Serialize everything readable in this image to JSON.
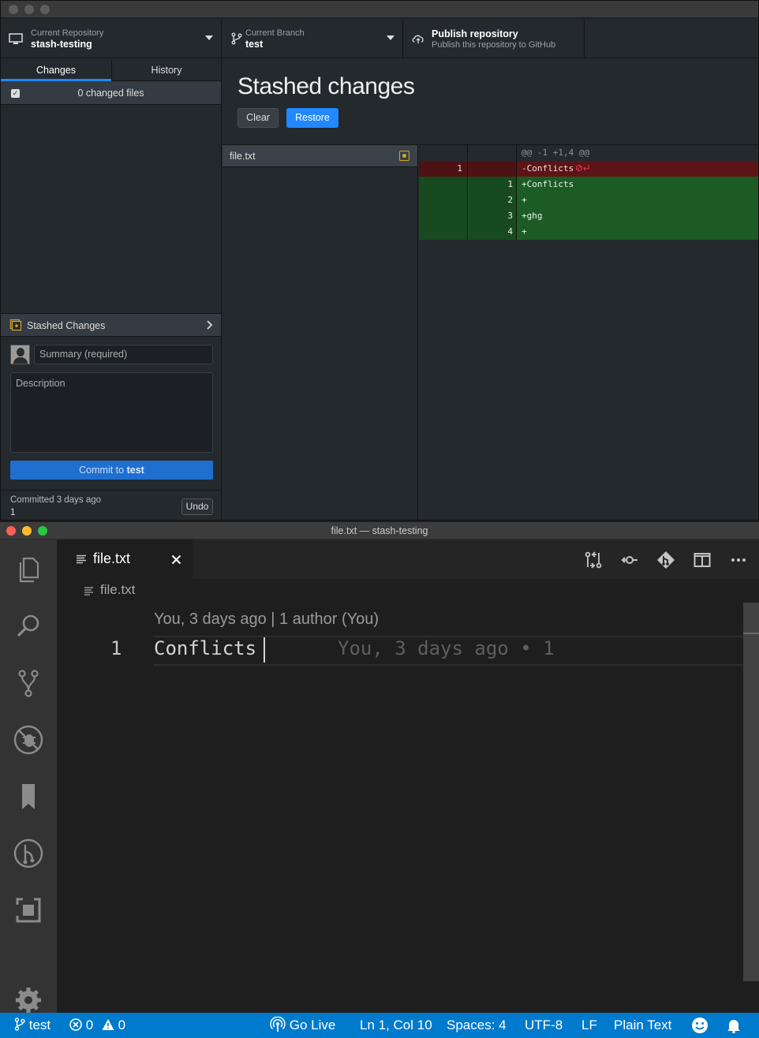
{
  "github_desktop": {
    "toolbar": {
      "repo_small": "Current Repository",
      "repo_name": "stash-testing",
      "branch_small": "Current Branch",
      "branch_name": "test",
      "publish_title": "Publish repository",
      "publish_sub": "Publish this repository to GitHub"
    },
    "tabs": [
      "Changes",
      "History"
    ],
    "changed_files": "0 changed files",
    "stashed_changes_label": "Stashed Changes",
    "summary_placeholder": "Summary (required)",
    "description_placeholder": "Description",
    "commit_prefix": "Commit to",
    "commit_branch": "test",
    "committed_label": "Committed 3 days ago",
    "committed_message": "1",
    "undo_label": "Undo",
    "main": {
      "title": "Stashed changes",
      "clear_label": "Clear",
      "restore_label": "Restore",
      "file_name": "file.txt"
    },
    "diff": {
      "hunk": "@@ -1 +1,4 @@",
      "lines": [
        {
          "type": "del",
          "old": "1",
          "new": "",
          "text": "-Conflicts"
        },
        {
          "type": "add",
          "old": "",
          "new": "1",
          "text": "+Conflicts"
        },
        {
          "type": "add",
          "old": "",
          "new": "2",
          "text": "+"
        },
        {
          "type": "add",
          "old": "",
          "new": "3",
          "text": "+ghg"
        },
        {
          "type": "add",
          "old": "",
          "new": "4",
          "text": "+"
        }
      ]
    }
  },
  "vscode": {
    "title": "file.txt — stash-testing",
    "tab_label": "file.txt",
    "breadcrumb": "file.txt",
    "codelens": "You, 3 days ago | 1 author (You)",
    "line_number": "1",
    "line_text": "Conflicts",
    "blame": "You, 3 days ago • 1",
    "status": {
      "branch": "test",
      "errors": "0",
      "warnings": "0",
      "go_live": "Go Live",
      "position": "Ln 1, Col 10",
      "spaces": "Spaces: 4",
      "encoding": "UTF-8",
      "eol": "LF",
      "language": "Plain Text"
    }
  },
  "colors": {
    "accent_blue": "#2188ff",
    "status_bar": "#007acc",
    "diff_deleted": "#5c1416",
    "diff_added": "#1d5b25"
  }
}
